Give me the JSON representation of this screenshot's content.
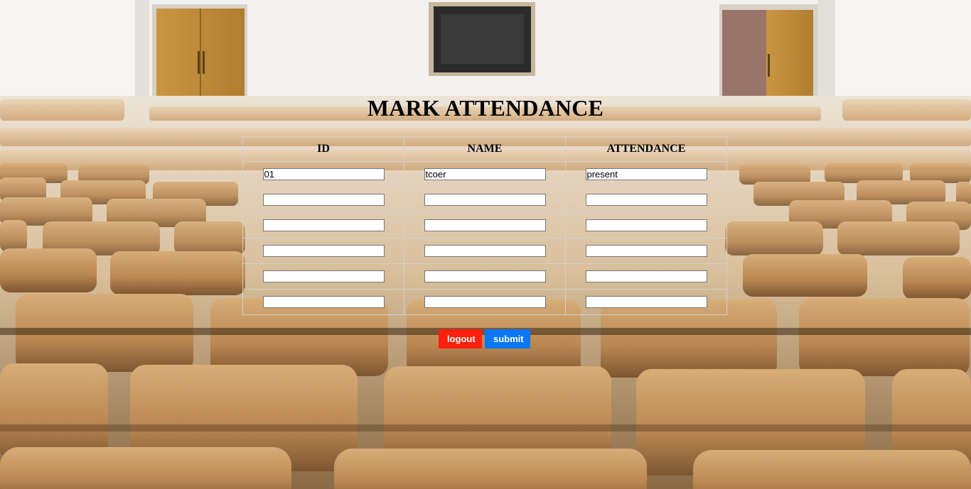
{
  "page": {
    "title": "MARK ATTENDANCE",
    "background_image": "lecture-hall-chairs"
  },
  "table": {
    "headers": [
      "ID",
      "NAME",
      "ATTENDANCE"
    ],
    "rows": [
      {
        "id": "01",
        "name": "tcoer",
        "attendance": "present"
      },
      {
        "id": "",
        "name": "",
        "attendance": ""
      },
      {
        "id": "",
        "name": "",
        "attendance": ""
      },
      {
        "id": "",
        "name": "",
        "attendance": ""
      },
      {
        "id": "",
        "name": "",
        "attendance": ""
      },
      {
        "id": "",
        "name": "",
        "attendance": ""
      }
    ]
  },
  "actions": {
    "logout_label": "logout",
    "submit_label": "submit"
  },
  "colors": {
    "logout": "#ff1f0f",
    "submit": "#0a77f5",
    "wood": "#c99d6a",
    "wall": "#f3f1ee"
  }
}
